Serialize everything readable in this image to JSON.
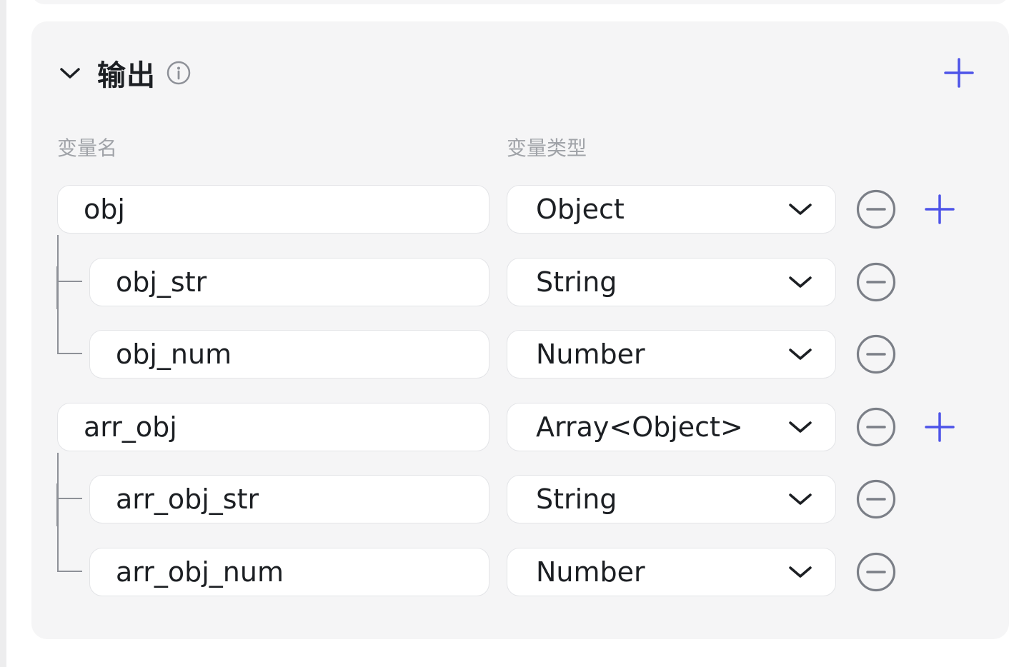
{
  "section": {
    "title": "输出",
    "icons": {
      "collapse": "chevron-down-icon",
      "info": "info-circle-icon",
      "add": "plus-icon"
    }
  },
  "columns": {
    "name_label": "变量名",
    "type_label": "变量类型"
  },
  "rows": [
    {
      "name": "obj",
      "type": "Object",
      "level": 0,
      "can_add_child": true
    },
    {
      "name": "obj_str",
      "type": "String",
      "level": 1,
      "can_add_child": false
    },
    {
      "name": "obj_num",
      "type": "Number",
      "level": 1,
      "can_add_child": false
    },
    {
      "name": "arr_obj",
      "type": "Array<Object>",
      "level": 0,
      "can_add_child": true
    },
    {
      "name": "arr_obj_str",
      "type": "String",
      "level": 1,
      "can_add_child": false
    },
    {
      "name": "arr_obj_num",
      "type": "Number",
      "level": 1,
      "can_add_child": false
    }
  ],
  "colors": {
    "accent": "#4d53e8",
    "panel_bg": "#f5f5f6",
    "text_primary": "#1c1f23",
    "text_secondary": "#a0a3a8",
    "icon_gray": "#7b7f87"
  }
}
